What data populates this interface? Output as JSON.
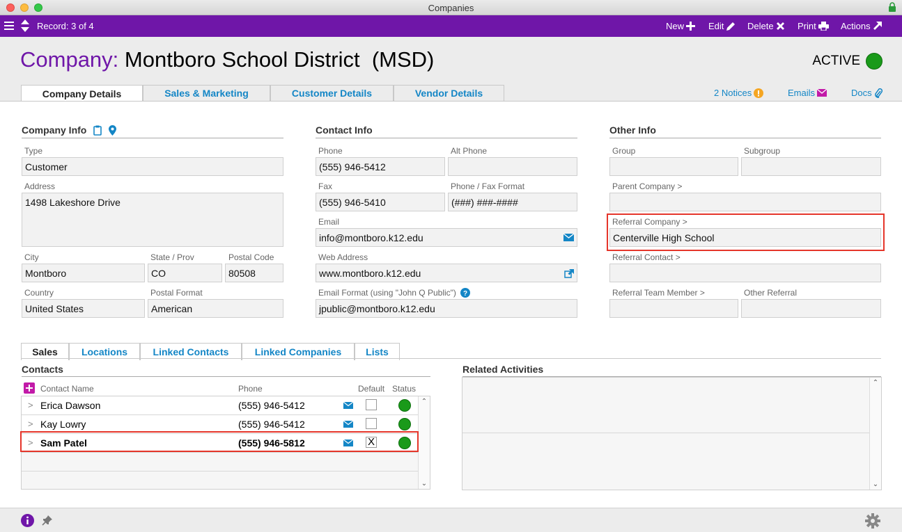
{
  "window": {
    "title": "Companies"
  },
  "toolbar": {
    "record_label": "Record: 3 of 4",
    "new_label": "New",
    "edit_label": "Edit",
    "delete_label": "Delete",
    "print_label": "Print",
    "actions_label": "Actions"
  },
  "header": {
    "company_label": "Company:",
    "company_name": "Montboro School District  (MSD)",
    "status": "ACTIVE",
    "tabs": [
      "Company Details",
      "Sales & Marketing",
      "Customer Details",
      "Vendor Details"
    ],
    "notices_label": "2 Notices",
    "emails_label": "Emails",
    "docs_label": "Docs"
  },
  "company_info": {
    "title": "Company Info",
    "type_label": "Type",
    "type": "Customer",
    "address_label": "Address",
    "address": "1498 Lakeshore Drive",
    "city_label": "City",
    "city": "Montboro",
    "state_label": "State / Prov",
    "state": "CO",
    "postal_label": "Postal Code",
    "postal": "80508",
    "country_label": "Country",
    "country": "United States",
    "postal_format_label": "Postal Format",
    "postal_format": "American"
  },
  "contact_info": {
    "title": "Contact Info",
    "phone_label": "Phone",
    "phone": "(555) 946-5412",
    "alt_phone_label": "Alt Phone",
    "alt_phone": "",
    "fax_label": "Fax",
    "fax": "(555) 946-5410",
    "format_label": "Phone / Fax Format",
    "format": "(###) ###-####",
    "email_label": "Email",
    "email": "info@montboro.k12.edu",
    "web_label": "Web Address",
    "web": "www.montboro.k12.edu",
    "email_format_label": "Email Format (using \"John Q Public\")",
    "email_format": "jpublic@montboro.k12.edu"
  },
  "other_info": {
    "title": "Other Info",
    "group_label": "Group",
    "group": "",
    "subgroup_label": "Subgroup",
    "subgroup": "",
    "parent_label": "Parent Company >",
    "parent": "",
    "referral_company_label": "Referral Company >",
    "referral_company": "Centerville High School",
    "referral_contact_label": "Referral Contact >",
    "referral_contact": "",
    "referral_team_label": "Referral Team Member >",
    "referral_team": "",
    "other_referral_label": "Other Referral",
    "other_referral": ""
  },
  "lower_tabs": [
    "Sales",
    "Locations",
    "Linked Contacts",
    "Linked Companies",
    "Lists"
  ],
  "contacts": {
    "title": "Contacts",
    "col_name": "Contact Name",
    "col_phone": "Phone",
    "col_default": "Default",
    "col_status": "Status",
    "rows": [
      {
        "name": "Erica Dawson",
        "phone": "(555) 946-5412",
        "default": ""
      },
      {
        "name": "Kay Lowry",
        "phone": "(555) 946-5412",
        "default": ""
      },
      {
        "name": "Sam Patel",
        "phone": "(555) 946-5812",
        "default": "X"
      }
    ]
  },
  "related": {
    "title": "Related Activities"
  },
  "colors": {
    "accent": "#6f16a8",
    "link": "#1486c6",
    "active": "#1a9a1a",
    "highlight": "#e5352a"
  }
}
